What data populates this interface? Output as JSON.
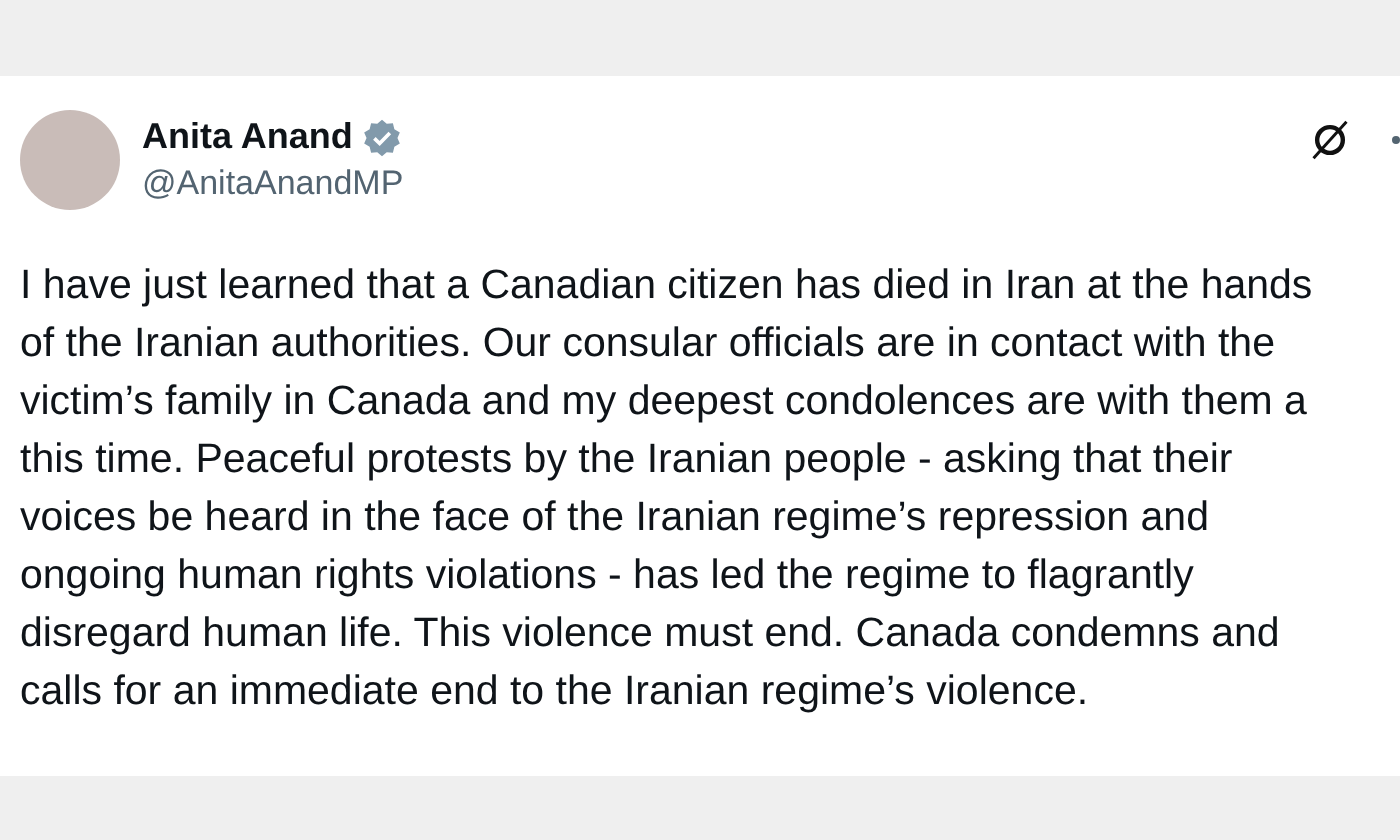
{
  "author": {
    "name": "Anita Anand",
    "verified": true,
    "handle": "@AnitaAnandMP"
  },
  "post": {
    "text": "I have just learned that a Canadian citizen has died in Iran at the hands\nof the Iranian authorities. Our consular officials are in contact with the\nvictim’s family in Canada and my deepest condolences are with them a\nthis time. Peaceful protests by the Iranian people - asking that their\nvoices be heard in the face of the Iranian regime’s repression and\nongoing human rights violations - has led the regime to flagrantly\ndisregard human life. This violence must end. Canada condemns and\ncalls for an immediate end to the Iranian regime’s violence."
  }
}
